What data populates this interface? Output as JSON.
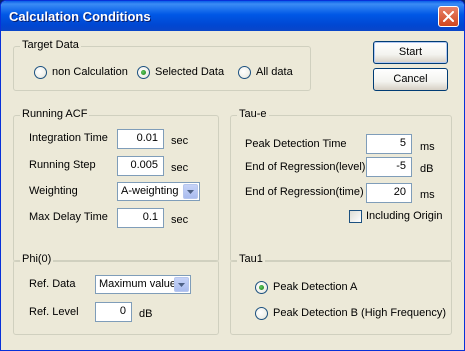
{
  "window": {
    "title": "Calculation Conditions"
  },
  "buttons": {
    "start_label": "Start",
    "cancel_label": "Cancel"
  },
  "target_data": {
    "title": "Target Data",
    "options": [
      "non Calculation",
      "Selected Data",
      "All data"
    ],
    "selected": "Selected Data"
  },
  "running_acf": {
    "title": "Running ACF",
    "integration_time": {
      "label": "Integration Time",
      "value": "0.01",
      "unit": "sec"
    },
    "running_step": {
      "label": "Running Step",
      "value": "0.005",
      "unit": "sec"
    },
    "weighting": {
      "label": "Weighting",
      "value": "A-weighting"
    },
    "max_delay_time": {
      "label": "Max Delay Time",
      "value": "0.1",
      "unit": "sec"
    }
  },
  "tau_e": {
    "title": "Tau-e",
    "peak_detection_time": {
      "label": "Peak Detection Time",
      "value": "5",
      "unit": "ms"
    },
    "end_regression_level": {
      "label": "End of Regression(level)",
      "value": "-5",
      "unit": "dB"
    },
    "end_regression_time": {
      "label": "End of Regression(time)",
      "value": "20",
      "unit": "ms"
    },
    "including_origin": {
      "label": "Including Origin",
      "checked": false
    }
  },
  "phi0": {
    "title": "Phi(0)",
    "ref_data": {
      "label": "Ref. Data",
      "value": "Maximum value"
    },
    "ref_level": {
      "label": "Ref. Level",
      "value": "0",
      "unit": "dB"
    }
  },
  "tau1": {
    "title": "Tau1",
    "options": [
      "Peak Detection A",
      "Peak Detection B (High Frequency)"
    ],
    "selected": "Peak Detection A"
  }
}
